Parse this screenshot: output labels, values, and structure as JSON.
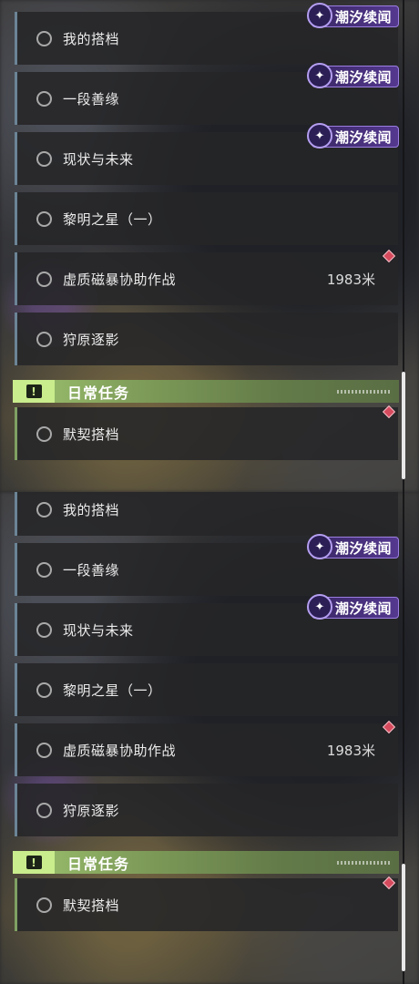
{
  "badge_text": "潮汐续闻",
  "badge_icon": "tide-emblem-icon",
  "section_title": "日常任务",
  "section_icon": "exclamation-icon",
  "quests": {
    "q1": "我的搭档",
    "q2": "一段善缘",
    "q3": "现状与未来",
    "q4": "黎明之星（一）",
    "q5": "虚质磁暴协助作战",
    "q5_distance": "1983米",
    "q6": "狩原逐影",
    "daily1": "默契搭档"
  },
  "colors": {
    "quest_bar": "#6c8496",
    "daily_bar": "#7fa062",
    "badge_bg": "#54388f",
    "section_bg": "#9cc26e",
    "tracker_marker": "#d64a5e"
  }
}
